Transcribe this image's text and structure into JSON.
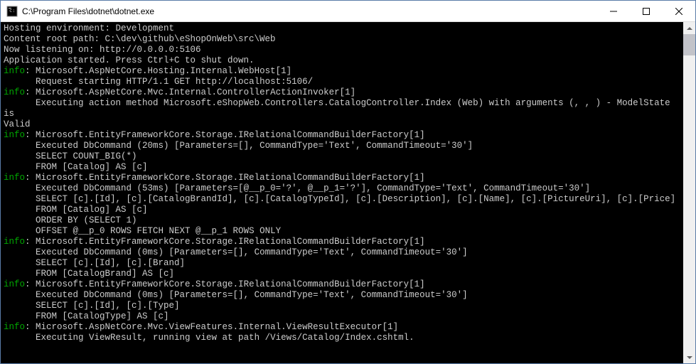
{
  "window": {
    "title": "C:\\Program Files\\dotnet\\dotnet.exe"
  },
  "log": {
    "header": [
      "Hosting environment: Development",
      "Content root path: C:\\dev\\github\\eShopOnWeb\\src\\Web",
      "Now listening on: http://0.0.0.0:5106",
      "Application started. Press Ctrl+C to shut down."
    ],
    "entries": [
      {
        "level": "info",
        "category": "Microsoft.AspNetCore.Hosting.Internal.WebHost[1]",
        "body": [
          "Request starting HTTP/1.1 GET http://localhost:5106/"
        ]
      },
      {
        "level": "info",
        "category": "Microsoft.AspNetCore.Mvc.Internal.ControllerActionInvoker[1]",
        "body": [
          "Executing action method Microsoft.eShopWeb.Controllers.CatalogController.Index (Web) with arguments (, , ) - ModelState is Valid"
        ]
      },
      {
        "level": "info",
        "category": "Microsoft.EntityFrameworkCore.Storage.IRelationalCommandBuilderFactory[1]",
        "body": [
          "Executed DbCommand (20ms) [Parameters=[], CommandType='Text', CommandTimeout='30']",
          "SELECT COUNT_BIG(*)",
          "FROM [Catalog] AS [c]"
        ]
      },
      {
        "level": "info",
        "category": "Microsoft.EntityFrameworkCore.Storage.IRelationalCommandBuilderFactory[1]",
        "body": [
          "Executed DbCommand (53ms) [Parameters=[@__p_0='?', @__p_1='?'], CommandType='Text', CommandTimeout='30']",
          "SELECT [c].[Id], [c].[CatalogBrandId], [c].[CatalogTypeId], [c].[Description], [c].[Name], [c].[PictureUri], [c].[Price]",
          "FROM [Catalog] AS [c]",
          "ORDER BY (SELECT 1)",
          "OFFSET @__p_0 ROWS FETCH NEXT @__p_1 ROWS ONLY"
        ]
      },
      {
        "level": "info",
        "category": "Microsoft.EntityFrameworkCore.Storage.IRelationalCommandBuilderFactory[1]",
        "body": [
          "Executed DbCommand (0ms) [Parameters=[], CommandType='Text', CommandTimeout='30']",
          "SELECT [c].[Id], [c].[Brand]",
          "FROM [CatalogBrand] AS [c]"
        ]
      },
      {
        "level": "info",
        "category": "Microsoft.EntityFrameworkCore.Storage.IRelationalCommandBuilderFactory[1]",
        "body": [
          "Executed DbCommand (0ms) [Parameters=[], CommandType='Text', CommandTimeout='30']",
          "SELECT [c].[Id], [c].[Type]",
          "FROM [CatalogType] AS [c]"
        ]
      },
      {
        "level": "info",
        "category": "Microsoft.AspNetCore.Mvc.ViewFeatures.Internal.ViewResultExecutor[1]",
        "body": [
          "Executing ViewResult, running view at path /Views/Catalog/Index.cshtml."
        ]
      }
    ]
  }
}
